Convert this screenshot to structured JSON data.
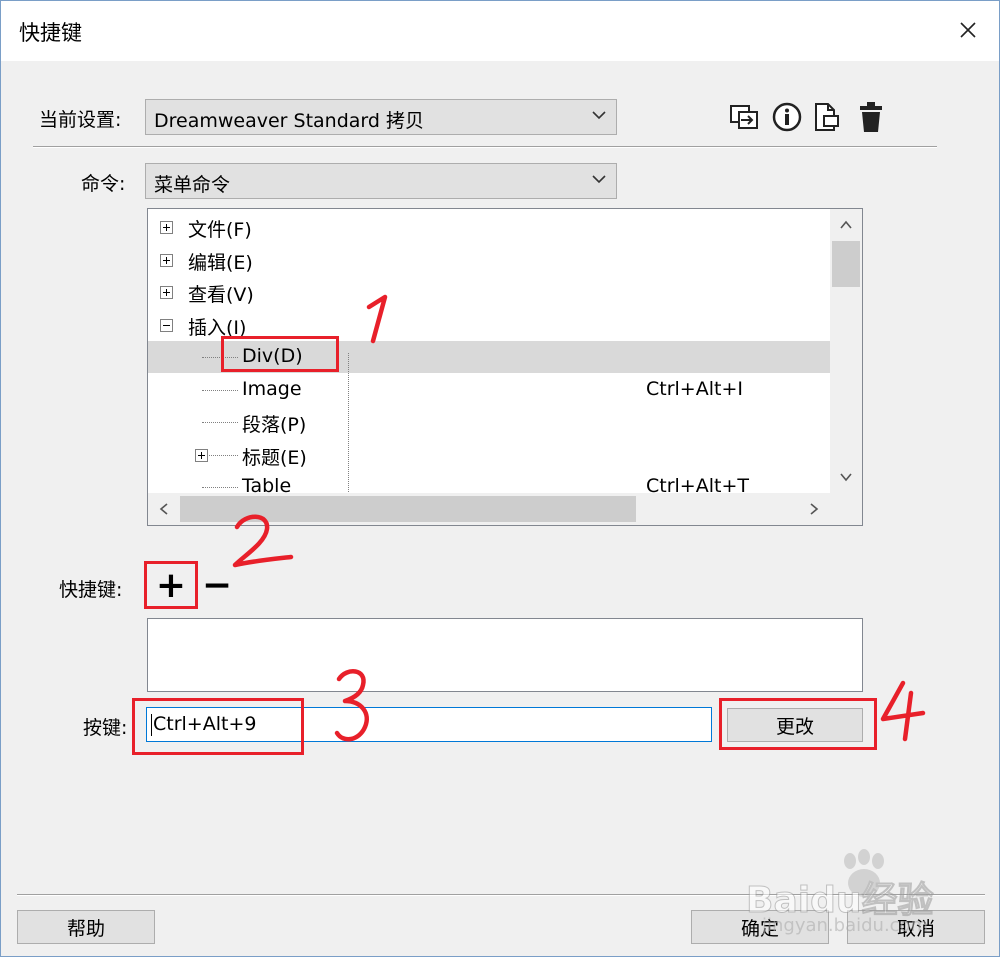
{
  "window": {
    "title": "快捷键"
  },
  "current_set": {
    "label": "当前设置:",
    "value": "Dreamweaver Standard 拷贝"
  },
  "commands": {
    "label": "命令:",
    "value": "菜单命令"
  },
  "tree": {
    "items": [
      {
        "label": "文件(F)",
        "shortcut": "",
        "expander": "plus"
      },
      {
        "label": "编辑(E)",
        "shortcut": "",
        "expander": "plus"
      },
      {
        "label": "查看(V)",
        "shortcut": "",
        "expander": "plus"
      },
      {
        "label": "插入(I)",
        "shortcut": "",
        "expander": "minus"
      },
      {
        "label": "Div(D)",
        "shortcut": "",
        "expander": "none"
      },
      {
        "label": "Image",
        "shortcut": "Ctrl+Alt+I",
        "expander": "none"
      },
      {
        "label": "段落(P)",
        "shortcut": "",
        "expander": "none"
      },
      {
        "label": "标题(E)",
        "shortcut": "",
        "expander": "plus"
      },
      {
        "label": "Table",
        "shortcut": "Ctrl+Alt+T",
        "expander": "none"
      }
    ],
    "selected_index": 4
  },
  "shortcuts": {
    "label": "快捷键:",
    "add": "+",
    "remove": "−"
  },
  "keystroke": {
    "label": "按键:",
    "value": "Ctrl+Alt+9",
    "change_button": "更改"
  },
  "footer": {
    "help": "帮助",
    "ok": "确定",
    "cancel": "取消"
  },
  "annotations": {
    "n1": "1",
    "n2": "2",
    "n3": "3",
    "n4": "4"
  },
  "watermark": {
    "brand": "Baidu经验",
    "url": "jingyan.baidu.com"
  },
  "colors": {
    "annotation_red": "#e8202a",
    "focus_blue": "#0078d7",
    "selection_gray": "#d9d9d9"
  },
  "icons": [
    "import-icon",
    "info-icon",
    "export-icon",
    "delete-icon"
  ]
}
